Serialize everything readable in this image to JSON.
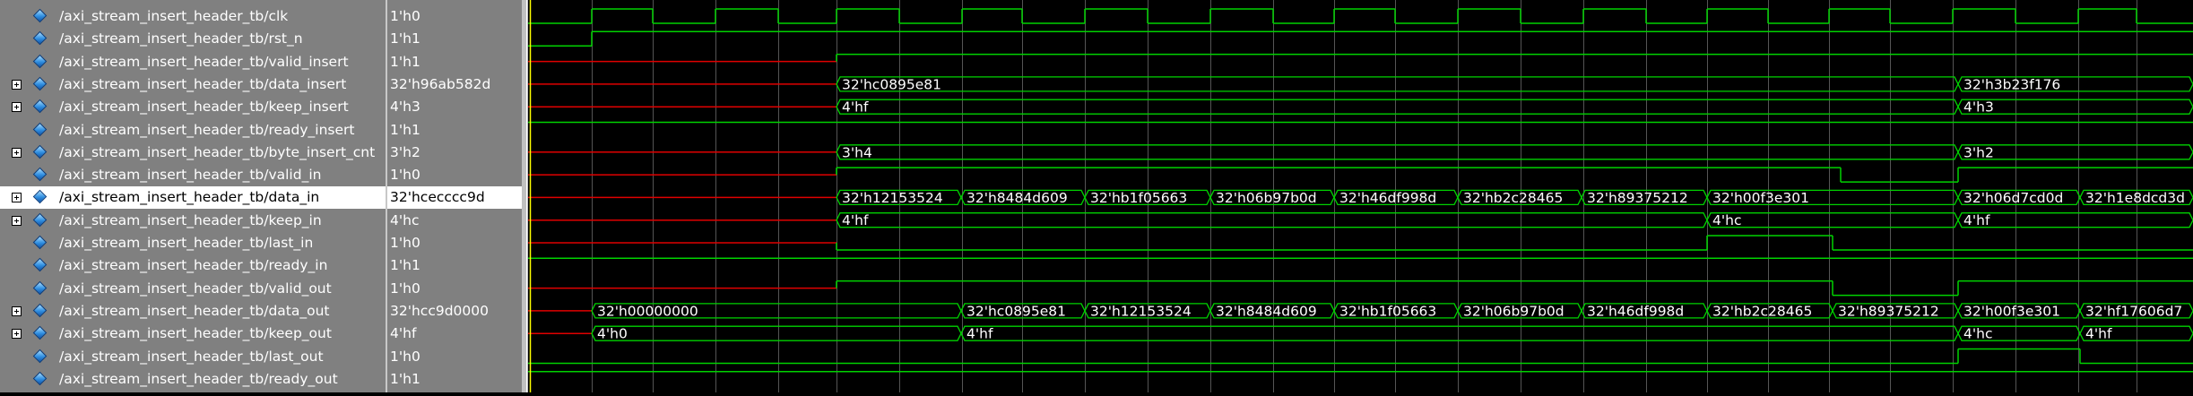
{
  "signals": [
    {
      "name": "/axi_stream_insert_header_tb/clk",
      "value": "1'h0",
      "expandable": false
    },
    {
      "name": "/axi_stream_insert_header_tb/rst_n",
      "value": "1'h1",
      "expandable": false
    },
    {
      "name": "/axi_stream_insert_header_tb/valid_insert",
      "value": "1'h1",
      "expandable": false
    },
    {
      "name": "/axi_stream_insert_header_tb/data_insert",
      "value": "32'h96ab582d",
      "expandable": true
    },
    {
      "name": "/axi_stream_insert_header_tb/keep_insert",
      "value": "4'h3",
      "expandable": true
    },
    {
      "name": "/axi_stream_insert_header_tb/ready_insert",
      "value": "1'h1",
      "expandable": false
    },
    {
      "name": "/axi_stream_insert_header_tb/byte_insert_cnt",
      "value": "3'h2",
      "expandable": true
    },
    {
      "name": "/axi_stream_insert_header_tb/valid_in",
      "value": "1'h0",
      "expandable": false
    },
    {
      "name": "/axi_stream_insert_header_tb/data_in",
      "value": "32'hcecccc9d",
      "expandable": true,
      "selected": true
    },
    {
      "name": "/axi_stream_insert_header_tb/keep_in",
      "value": "4'hc",
      "expandable": true
    },
    {
      "name": "/axi_stream_insert_header_tb/last_in",
      "value": "1'h0",
      "expandable": false
    },
    {
      "name": "/axi_stream_insert_header_tb/ready_in",
      "value": "1'h1",
      "expandable": false
    },
    {
      "name": "/axi_stream_insert_header_tb/valid_out",
      "value": "1'h0",
      "expandable": false
    },
    {
      "name": "/axi_stream_insert_header_tb/data_out",
      "value": "32'hcc9d0000",
      "expandable": true
    },
    {
      "name": "/axi_stream_insert_header_tb/keep_out",
      "value": "4'hf",
      "expandable": true
    },
    {
      "name": "/axi_stream_insert_header_tb/last_out",
      "value": "1'h0",
      "expandable": false
    },
    {
      "name": "/axi_stream_insert_header_tb/ready_out",
      "value": "1'h1",
      "expandable": false
    }
  ],
  "colors": {
    "signal": "#00d200",
    "undefined": "#e00000",
    "cursor": "#ffff00",
    "grid": "#555555"
  },
  "waves": {
    "clk": {
      "type": "clock",
      "segments": [
        [
          0,
          72,
          0
        ],
        [
          72,
          140,
          1
        ],
        [
          140,
          210,
          0
        ],
        [
          210,
          280,
          1
        ],
        [
          280,
          345,
          0
        ],
        [
          345,
          415,
          1
        ],
        [
          415,
          485,
          0
        ],
        [
          485,
          552,
          1
        ],
        [
          552,
          622,
          0
        ],
        [
          622,
          692,
          1
        ],
        [
          692,
          762,
          0
        ],
        [
          762,
          832,
          1
        ],
        [
          832,
          900,
          0
        ],
        [
          900,
          968,
          1
        ],
        [
          968,
          1038,
          0
        ],
        [
          1038,
          1108,
          1
        ],
        [
          1108,
          1178,
          0
        ],
        [
          1178,
          1248,
          1
        ],
        [
          1248,
          1316,
          0
        ],
        [
          1316,
          1384,
          1
        ],
        [
          1384,
          1452,
          0
        ],
        [
          1452,
          1520,
          1
        ],
        [
          1520,
          1590,
          0
        ],
        [
          1590,
          1660,
          1
        ],
        [
          1660,
          1730,
          0
        ],
        [
          1730,
          1795,
          1
        ],
        [
          1795,
          1858,
          0
        ]
      ]
    },
    "rst_n": {
      "type": "bit",
      "segments": [
        [
          0,
          72,
          0
        ],
        [
          72,
          1858,
          1
        ]
      ]
    },
    "valid_insert": {
      "type": "bit",
      "segments": [
        [
          0,
          345,
          "x"
        ],
        [
          345,
          1858,
          1
        ]
      ]
    },
    "data_insert": {
      "type": "bus",
      "segments": [
        [
          0,
          345,
          "x",
          ""
        ],
        [
          345,
          1596,
          "v",
          "32'hc0895e81"
        ],
        [
          1596,
          1858,
          "v",
          "32'h3b23f176"
        ]
      ]
    },
    "keep_insert": {
      "type": "bus",
      "segments": [
        [
          0,
          345,
          "x",
          ""
        ],
        [
          345,
          1596,
          "v",
          "4'hf"
        ],
        [
          1596,
          1858,
          "v",
          "4'h3"
        ]
      ]
    },
    "ready_insert": {
      "type": "bit",
      "segments": [
        [
          0,
          1858,
          1
        ]
      ]
    },
    "byte_insert_cnt": {
      "type": "bus",
      "segments": [
        [
          0,
          345,
          "x",
          ""
        ],
        [
          345,
          1596,
          "v",
          "3'h4"
        ],
        [
          1596,
          1858,
          "v",
          "3'h2"
        ]
      ]
    },
    "valid_in": {
      "type": "bit",
      "segments": [
        [
          0,
          345,
          "x"
        ],
        [
          345,
          1465,
          1
        ],
        [
          1465,
          1596,
          0
        ],
        [
          1596,
          1858,
          1
        ]
      ]
    },
    "data_in": {
      "type": "bus",
      "segments": [
        [
          0,
          345,
          "x",
          ""
        ],
        [
          345,
          484,
          "v",
          "32'h12153524"
        ],
        [
          484,
          622,
          "v",
          "32'h8484d609"
        ],
        [
          622,
          762,
          "v",
          "32'hb1f05663"
        ],
        [
          762,
          900,
          "v",
          "32'h06b97b0d"
        ],
        [
          900,
          1038,
          "v",
          "32'h46df998d"
        ],
        [
          1038,
          1176,
          "v",
          "32'hb2c28465"
        ],
        [
          1176,
          1316,
          "v",
          "32'h89375212"
        ],
        [
          1316,
          1596,
          "v",
          "32'h00f3e301"
        ],
        [
          1596,
          1732,
          "v",
          "32'h06d7cd0d"
        ],
        [
          1732,
          1858,
          "v",
          "32'h1e8dcd3d"
        ]
      ]
    },
    "keep_in": {
      "type": "bus",
      "segments": [
        [
          0,
          345,
          "x",
          ""
        ],
        [
          345,
          1316,
          "v",
          "4'hf"
        ],
        [
          1316,
          1596,
          "v",
          "4'hc"
        ],
        [
          1596,
          1858,
          "v",
          "4'hf"
        ]
      ]
    },
    "last_in": {
      "type": "bit",
      "segments": [
        [
          0,
          345,
          "x"
        ],
        [
          345,
          1316,
          0
        ],
        [
          1316,
          1456,
          1
        ],
        [
          1456,
          1858,
          0
        ]
      ]
    },
    "ready_in": {
      "type": "bit",
      "segments": [
        [
          0,
          1858,
          1
        ]
      ]
    },
    "valid_out": {
      "type": "bit",
      "segments": [
        [
          0,
          345,
          "x"
        ],
        [
          345,
          1456,
          1
        ],
        [
          1456,
          1596,
          0
        ],
        [
          1596,
          1858,
          1
        ]
      ]
    },
    "data_out": {
      "type": "bus",
      "segments": [
        [
          0,
          72,
          "x",
          ""
        ],
        [
          72,
          484,
          "v",
          "32'h00000000"
        ],
        [
          484,
          622,
          "v",
          "32'hc0895e81"
        ],
        [
          622,
          762,
          "v",
          "32'h12153524"
        ],
        [
          762,
          900,
          "v",
          "32'h8484d609"
        ],
        [
          900,
          1038,
          "v",
          "32'hb1f05663"
        ],
        [
          1038,
          1176,
          "v",
          "32'h06b97b0d"
        ],
        [
          1176,
          1316,
          "v",
          "32'h46df998d"
        ],
        [
          1316,
          1456,
          "v",
          "32'hb2c28465"
        ],
        [
          1456,
          1596,
          "v",
          "32'h89375212"
        ],
        [
          1596,
          1732,
          "v",
          "32'h00f3e301"
        ],
        [
          1732,
          1858,
          "v",
          "32'hf17606d7"
        ]
      ]
    },
    "keep_out": {
      "type": "bus",
      "segments": [
        [
          0,
          72,
          "x",
          ""
        ],
        [
          72,
          484,
          "v",
          "4'h0"
        ],
        [
          484,
          1596,
          "v",
          "4'hf"
        ],
        [
          1596,
          1732,
          "v",
          "4'hc"
        ],
        [
          1732,
          1858,
          "v",
          "4'hf"
        ]
      ]
    },
    "last_out": {
      "type": "bit",
      "segments": [
        [
          0,
          1596,
          0
        ],
        [
          1596,
          1732,
          1
        ],
        [
          1732,
          1858,
          0
        ]
      ]
    },
    "ready_out": {
      "type": "bit",
      "segments": [
        [
          0,
          1858,
          1
        ]
      ]
    }
  }
}
